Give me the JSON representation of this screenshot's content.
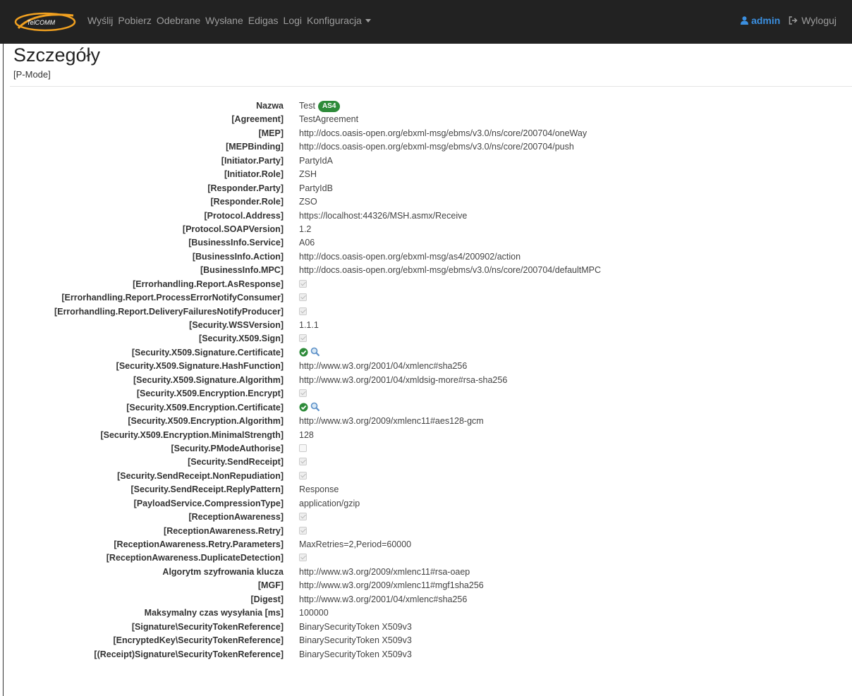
{
  "navbar": {
    "logo_text": "TelCOMM",
    "links": [
      "Wyślij",
      "Pobierz",
      "Odebrane",
      "Wysłane",
      "Edigas",
      "Logi",
      "Konfiguracja"
    ],
    "user": "admin",
    "logout": "Wyloguj"
  },
  "page": {
    "title": "Szczegóły",
    "subtitle": "[P-Mode]"
  },
  "badge": "AS4",
  "colors": {
    "navbar_bg": "#222222",
    "user_link": "#3b8fe0",
    "badge_green": "#2e8b3a",
    "ok_icon": "#2e8b3a"
  },
  "rows": [
    {
      "label": "Nazwa",
      "value": "Test",
      "type": "name"
    },
    {
      "label": "[Agreement]",
      "value": "TestAgreement",
      "type": "text"
    },
    {
      "label": "[MEP]",
      "value": "http://docs.oasis-open.org/ebxml-msg/ebms/v3.0/ns/core/200704/oneWay",
      "type": "text"
    },
    {
      "label": "[MEPBinding]",
      "value": "http://docs.oasis-open.org/ebxml-msg/ebms/v3.0/ns/core/200704/push",
      "type": "text"
    },
    {
      "label": "[Initiator.Party]",
      "value": "PartyIdA",
      "type": "text"
    },
    {
      "label": "[Initiator.Role]",
      "value": "ZSH",
      "type": "text"
    },
    {
      "label": "[Responder.Party]",
      "value": "PartyIdB",
      "type": "text"
    },
    {
      "label": "[Responder.Role]",
      "value": "ZSO",
      "type": "text"
    },
    {
      "label": "[Protocol.Address]",
      "value": "https://localhost:44326/MSH.asmx/Receive",
      "type": "text"
    },
    {
      "label": "[Protocol.SOAPVersion]",
      "value": "1.2",
      "type": "text"
    },
    {
      "label": "[BusinessInfo.Service]",
      "value": "A06",
      "type": "text"
    },
    {
      "label": "[BusinessInfo.Action]",
      "value": "http://docs.oasis-open.org/ebxml-msg/as4/200902/action",
      "type": "text"
    },
    {
      "label": "[BusinessInfo.MPC]",
      "value": "http://docs.oasis-open.org/ebxml-msg/ebms/v3.0/ns/core/200704/defaultMPC",
      "type": "text"
    },
    {
      "label": "[Errorhandling.Report.AsResponse]",
      "value": "",
      "type": "check-on"
    },
    {
      "label": "[Errorhandling.Report.ProcessErrorNotifyConsumer]",
      "value": "",
      "type": "check-on"
    },
    {
      "label": "[Errorhandling.Report.DeliveryFailuresNotifyProducer]",
      "value": "",
      "type": "check-on"
    },
    {
      "label": "[Security.WSSVersion]",
      "value": "1.1.1",
      "type": "text"
    },
    {
      "label": "[Security.X509.Sign]",
      "value": "",
      "type": "check-on"
    },
    {
      "label": "[Security.X509.Signature.Certificate]",
      "value": "",
      "type": "cert"
    },
    {
      "label": "[Security.X509.Signature.HashFunction]",
      "value": "http://www.w3.org/2001/04/xmlenc#sha256",
      "type": "text"
    },
    {
      "label": "[Security.X509.Signature.Algorithm]",
      "value": "http://www.w3.org/2001/04/xmldsig-more#rsa-sha256",
      "type": "text"
    },
    {
      "label": "[Security.X509.Encryption.Encrypt]",
      "value": "",
      "type": "check-on"
    },
    {
      "label": "[Security.X509.Encryption.Certificate]",
      "value": "",
      "type": "cert"
    },
    {
      "label": "[Security.X509.Encryption.Algorithm]",
      "value": "http://www.w3.org/2009/xmlenc11#aes128-gcm",
      "type": "text"
    },
    {
      "label": "[Security.X509.Encryption.MinimalStrength]",
      "value": "128",
      "type": "text"
    },
    {
      "label": "[Security.PModeAuthorise]",
      "value": "",
      "type": "check-off"
    },
    {
      "label": "[Security.SendReceipt]",
      "value": "",
      "type": "check-on"
    },
    {
      "label": "[Security.SendReceipt.NonRepudiation]",
      "value": "",
      "type": "check-on"
    },
    {
      "label": "[Security.SendReceipt.ReplyPattern]",
      "value": "Response",
      "type": "text"
    },
    {
      "label": "[PayloadService.CompressionType]",
      "value": "application/gzip",
      "type": "text"
    },
    {
      "label": "[ReceptionAwareness]",
      "value": "",
      "type": "check-on"
    },
    {
      "label": "[ReceptionAwareness.Retry]",
      "value": "",
      "type": "check-on"
    },
    {
      "label": "[ReceptionAwareness.Retry.Parameters]",
      "value": "MaxRetries=2,Period=60000",
      "type": "text"
    },
    {
      "label": "[ReceptionAwareness.DuplicateDetection]",
      "value": "",
      "type": "check-on"
    },
    {
      "label": "Algorytm szyfrowania klucza",
      "value": "http://www.w3.org/2009/xmlenc11#rsa-oaep",
      "type": "text"
    },
    {
      "label": "[MGF]",
      "value": "http://www.w3.org/2009/xmlenc11#mgf1sha256",
      "type": "text"
    },
    {
      "label": "[Digest]",
      "value": "http://www.w3.org/2001/04/xmlenc#sha256",
      "type": "text"
    },
    {
      "label": "Maksymalny czas wysyłania [ms]",
      "value": "100000",
      "type": "text"
    },
    {
      "label": "[Signature\\SecurityTokenReference]",
      "value": "BinarySecurityToken X509v3",
      "type": "text"
    },
    {
      "label": "[EncryptedKey\\SecurityTokenReference]",
      "value": "BinarySecurityToken X509v3",
      "type": "text"
    },
    {
      "label": "[(Receipt)Signature\\SecurityTokenReference]",
      "value": "BinarySecurityToken X509v3",
      "type": "text"
    }
  ]
}
